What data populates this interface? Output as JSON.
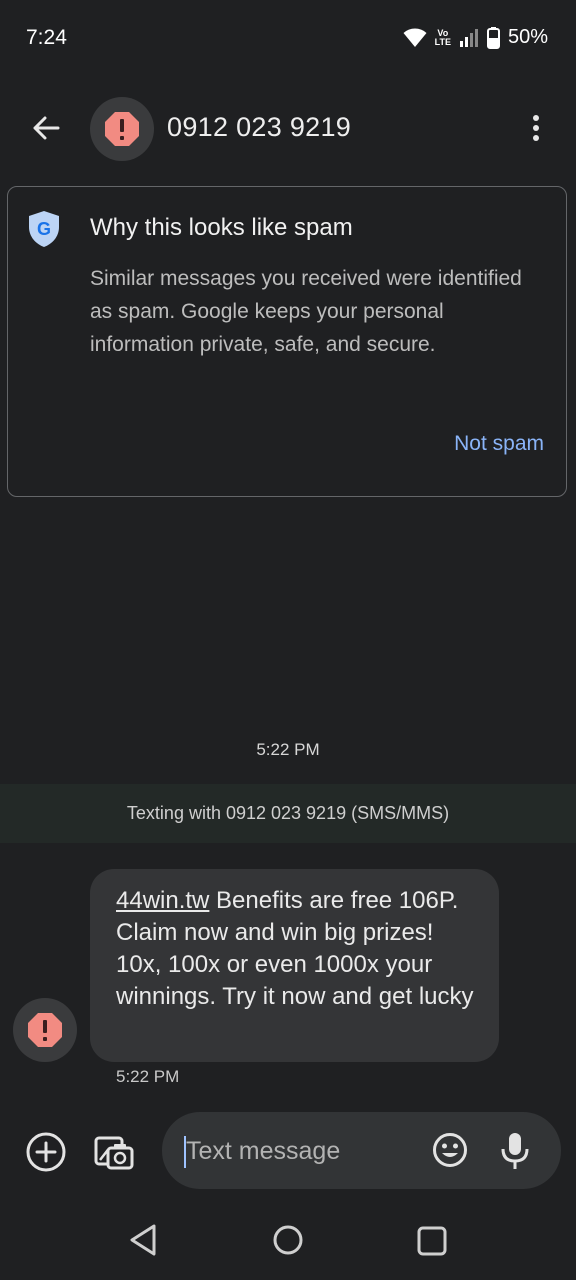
{
  "status": {
    "time": "7:24",
    "battery": "50%",
    "volte_top": "Vo",
    "volte_bottom": "LTE"
  },
  "header": {
    "title": "0912 023 9219",
    "icons": [
      "back-arrow-icon",
      "spam-alert-icon",
      "more-vert-icon"
    ]
  },
  "spam_card": {
    "title": "Why this looks like spam",
    "body": "Similar messages you received were identified as spam. Google keeps your personal information private, safe, and secure.",
    "action": "Not spam",
    "shield_letter": "G"
  },
  "conversation": {
    "timestamp": "5:22 PM",
    "texting_with": "Texting with 0912 023 9219 (SMS/MMS)",
    "message": {
      "link": "44win.tw",
      "text": " Benefits are free 106P. Claim now and win big prizes! 10x, 100x or even 1000x your winnings. Try it now and get lucky",
      "time": "5:22 PM"
    }
  },
  "compose": {
    "placeholder": "Text message"
  },
  "colors": {
    "background": "#1f2022",
    "accent_link": "#8ab4f8",
    "spam_red": "#f28b82",
    "bubble": "#343537"
  }
}
